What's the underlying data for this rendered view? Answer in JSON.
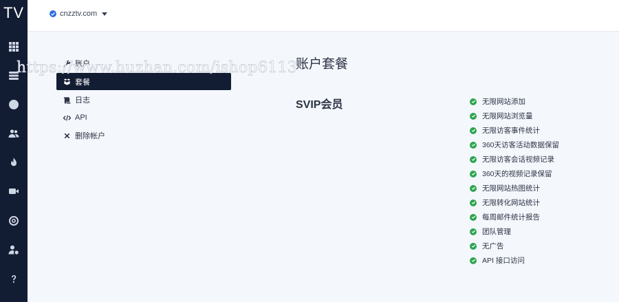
{
  "app": {
    "logo": "TV"
  },
  "rail": {
    "icons": [
      "grid-icon",
      "server-icon",
      "clock-icon",
      "users-icon",
      "fire-icon",
      "video-icon",
      "target-icon",
      "user-gear-icon",
      "help-icon"
    ]
  },
  "topbar": {
    "site_name": "cnzztv.com"
  },
  "menu": {
    "items": [
      {
        "label": "账户",
        "icon": "wrench-icon"
      },
      {
        "label": "套餐",
        "icon": "package-icon"
      },
      {
        "label": "日志",
        "icon": "scroll-icon"
      },
      {
        "label": "API",
        "icon": "code-icon"
      },
      {
        "label": "删除帐户",
        "icon": "close-icon"
      }
    ],
    "active_index": 1
  },
  "plan": {
    "title": "账户套餐",
    "name": "SVIP会员",
    "features": [
      "无限网站添加",
      "无限网站浏览量",
      "无限访客事件统计",
      "360天访客活动数据保留",
      "无限访客会话视频记录",
      "360天的视频记录保留",
      "无限网站热图统计",
      "无限转化网站统计",
      "每周邮件统计报告",
      "团队管理",
      "无广告",
      "API 接口访问"
    ]
  },
  "watermark": {
    "text": "https://www.huzhan.com/ishop6113"
  },
  "colors": {
    "sidebar": "#121c33",
    "accent": "#2d6cdf",
    "check": "#2ea44f",
    "background": "#f4f7fb"
  }
}
